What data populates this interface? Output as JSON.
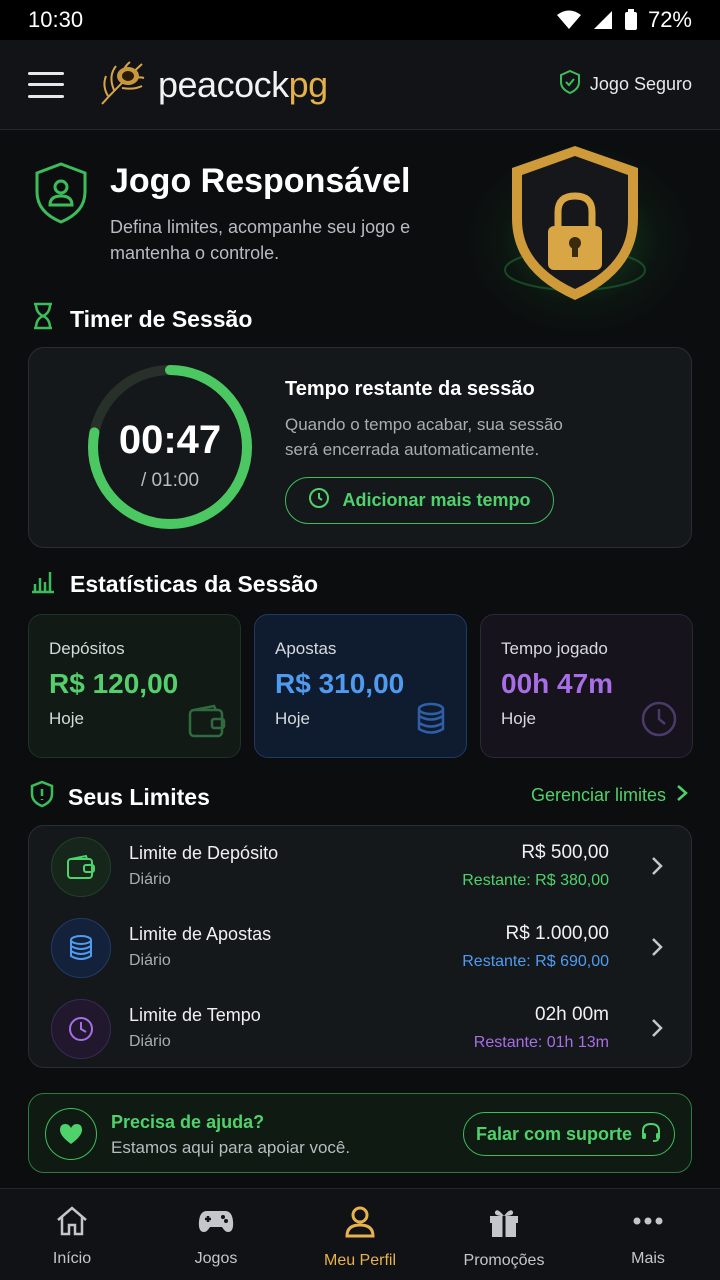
{
  "status_bar": {
    "time": "10:30",
    "battery": "72%"
  },
  "header": {
    "logo_part1": "peacock",
    "logo_part2": "pg",
    "safe_label": "Jogo Seguro"
  },
  "hero": {
    "title": "Jogo Responsável",
    "description": "Defina limites, acompanhe seu jogo e mantenha o controle."
  },
  "timer": {
    "section_title": "Timer de Sessão",
    "remaining": "00:47",
    "total": "/ 01:00",
    "progress": 0.78,
    "card_title": "Tempo restante da sessão",
    "card_desc": "Quando o tempo acabar, sua sessão será encerrada automaticamente.",
    "add_button": "Adicionar mais tempo"
  },
  "stats": {
    "section_title": "Estatísticas da Sessão",
    "deposits": {
      "label": "Depósitos",
      "value": "R$ 120,00",
      "sub": "Hoje"
    },
    "bets": {
      "label": "Apostas",
      "value": "R$ 310,00",
      "sub": "Hoje"
    },
    "time": {
      "label": "Tempo jogado",
      "value": "00h 47m",
      "sub": "Hoje"
    }
  },
  "limits": {
    "section_title": "Seus Limites",
    "manage_link": "Gerenciar limites",
    "items": [
      {
        "name": "Limite de Depósito",
        "period": "Diário",
        "amount": "R$ 500,00",
        "remaining": "Restante: R$ 380,00",
        "color": "#4fd16b"
      },
      {
        "name": "Limite de Apostas",
        "period": "Diário",
        "amount": "R$ 1.000,00",
        "remaining": "Restante: R$ 690,00",
        "color": "#4f9bf0"
      },
      {
        "name": "Limite de Tempo",
        "period": "Diário",
        "amount": "02h 00m",
        "remaining": "Restante: 01h 13m",
        "color": "#a76ee6"
      }
    ]
  },
  "help": {
    "title": "Precisa de ajuda?",
    "subtitle": "Estamos aqui para apoiar você.",
    "button": "Falar com suporte"
  },
  "nav": {
    "items": [
      {
        "label": "Início",
        "icon": "home-icon"
      },
      {
        "label": "Jogos",
        "icon": "gamepad-icon"
      },
      {
        "label": "Meu Perfil",
        "icon": "user-icon",
        "active": true
      },
      {
        "label": "Promoções",
        "icon": "gift-icon"
      },
      {
        "label": "Mais",
        "icon": "more-icon"
      }
    ]
  },
  "colors": {
    "accent_green": "#4fd16b",
    "accent_blue": "#4f9bf0",
    "accent_purple": "#a76ee6",
    "accent_gold": "#e8b24e"
  }
}
